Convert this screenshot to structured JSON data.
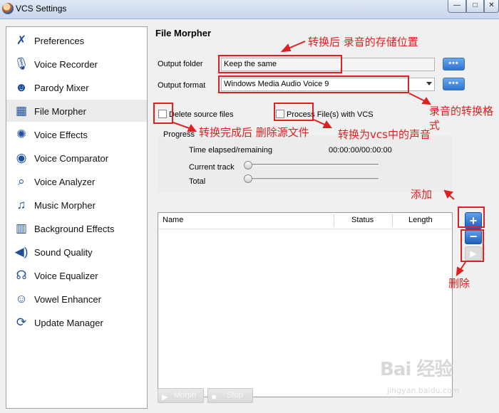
{
  "window": {
    "title": "VCS Settings",
    "buttons": {
      "minimize": "—",
      "maximize": "□",
      "close": "✕"
    }
  },
  "sidebar": {
    "items": [
      {
        "label": "Preferences",
        "icon": "wrench-tools-icon"
      },
      {
        "label": "Voice Recorder",
        "icon": "microphone-icon"
      },
      {
        "label": "Parody Mixer",
        "icon": "face-mask-icon"
      },
      {
        "label": "File Morpher",
        "icon": "file-morph-icon",
        "selected": true
      },
      {
        "label": "Voice Effects",
        "icon": "sparkle-effects-icon"
      },
      {
        "label": "Voice Comparator",
        "icon": "lips-compare-icon"
      },
      {
        "label": "Voice Analyzer",
        "icon": "magnifier-wave-icon"
      },
      {
        "label": "Music Morpher",
        "icon": "music-notes-icon"
      },
      {
        "label": "Background Effects",
        "icon": "equalizer-bars-icon"
      },
      {
        "label": "Sound Quality",
        "icon": "speaker-icon"
      },
      {
        "label": "Voice Equalizer",
        "icon": "equalizer-mouth-icon"
      },
      {
        "label": "Vowel Enhancer",
        "icon": "head-speaking-icon"
      },
      {
        "label": "Update Manager",
        "icon": "refresh-arrows-icon"
      }
    ]
  },
  "main": {
    "heading": "File Morpher",
    "output_folder_label": "Output folder",
    "output_folder_value": "Keep the same",
    "output_format_label": "Output format",
    "output_format_value": "Windows Media Audio Voice 9",
    "browse_label": "•••",
    "delete_source_label": "Delete source files",
    "process_label": "Process File(s) with VCS",
    "progress": {
      "title": "Progress",
      "time_label": "Time elapsed/remaining",
      "time_value": "00:00:00/00:00:00",
      "current_track_label": "Current track",
      "total_label": "Total",
      "current_track_fraction": 0,
      "total_fraction": 0
    },
    "table": {
      "columns": [
        "Name",
        "Status",
        "Length"
      ],
      "rows": []
    },
    "side_buttons": {
      "add": "+",
      "remove": "−",
      "play": "▶"
    },
    "morph_label": "Morph",
    "stop_label": "Stop"
  },
  "annotations": {
    "output_folder_note": "转换后 录音的存储位置",
    "output_format_note_line1": "录音的转换格",
    "output_format_note_line2": "式",
    "delete_note": "转换完成后 删除源文件",
    "process_note": "转换为vcs中的声音",
    "add_note": "添加",
    "remove_note": "删除",
    "color": "#e02020"
  },
  "watermark": {
    "main": "Bai 经验",
    "sub": "jingyan.baidu.com"
  }
}
